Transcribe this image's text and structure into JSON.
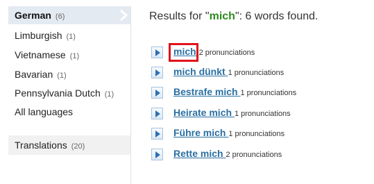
{
  "sidebar": {
    "languages": [
      {
        "name": "German",
        "count": "(6)",
        "selected": true
      },
      {
        "name": "Limburgish",
        "count": "(1)"
      },
      {
        "name": "Vietnamese",
        "count": "(1)"
      },
      {
        "name": "Bavarian",
        "count": "(1)"
      },
      {
        "name": "Pennsylvania Dutch",
        "count": "(1)"
      },
      {
        "name": "All languages",
        "count": ""
      }
    ],
    "translations": {
      "name": "Translations",
      "count": "(20)"
    }
  },
  "results": {
    "prefix": "Results for \"",
    "term": "mich",
    "suffix": "\": 6 words found.",
    "words": [
      {
        "word": "mich",
        "pronunciations": "2 pronunciations"
      },
      {
        "word": "mich dünkt",
        "pronunciations": "1 pronunciations"
      },
      {
        "word": "Bestrafe mich",
        "pronunciations": "1 pronunciations"
      },
      {
        "word": "Heirate mich",
        "pronunciations": "1 pronunciations"
      },
      {
        "word": "Führe mich",
        "pronunciations": "1 pronunciations"
      },
      {
        "word": "Rette mich",
        "pronunciations": "2 pronunciations"
      }
    ]
  },
  "colors": {
    "selected_bg": "#e4eaf2",
    "term_green": "#2c8a1e",
    "link_blue": "#2a6fa3",
    "highlight_red": "#e0131b"
  },
  "icons": {
    "play": "play-icon",
    "selected_arrow": "chevron-right-icon"
  }
}
